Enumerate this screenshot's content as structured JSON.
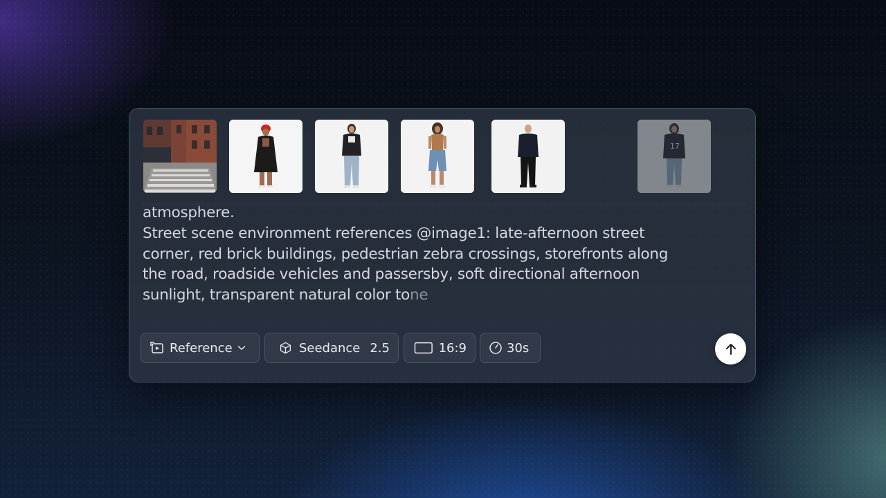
{
  "composer": {
    "reference_images": [
      {
        "icon": "street-scene-thumbnail"
      },
      {
        "icon": "person-red-hat-coat-thumbnail"
      },
      {
        "icon": "person-jeans-thumbnail"
      },
      {
        "icon": "person-denim-shorts-thumbnail"
      },
      {
        "icon": "person-dark-outfit-thumbnail"
      },
      {
        "icon": "person-jersey-17-thumbnail"
      }
    ],
    "prompt_lines": [
      "atmosphere.",
      "Street scene environment references @image1: late-afternoon street",
      "corner, red brick buildings, pedestrian zebra crossings, storefronts along",
      "the road, roadside vehicles and passersby, soft directional afternoon",
      "sunlight, transparent natural color to"
    ],
    "prompt_faded_tail": "ne"
  },
  "toolbar": {
    "mode_label": "Reference",
    "model_name": "Seedance",
    "model_version": "2.5",
    "aspect_ratio": "16:9",
    "duration": "30s"
  },
  "colors": {
    "card_bg": "#2c3442",
    "text": "#d3d8e0",
    "send_button": "#ffffff"
  }
}
